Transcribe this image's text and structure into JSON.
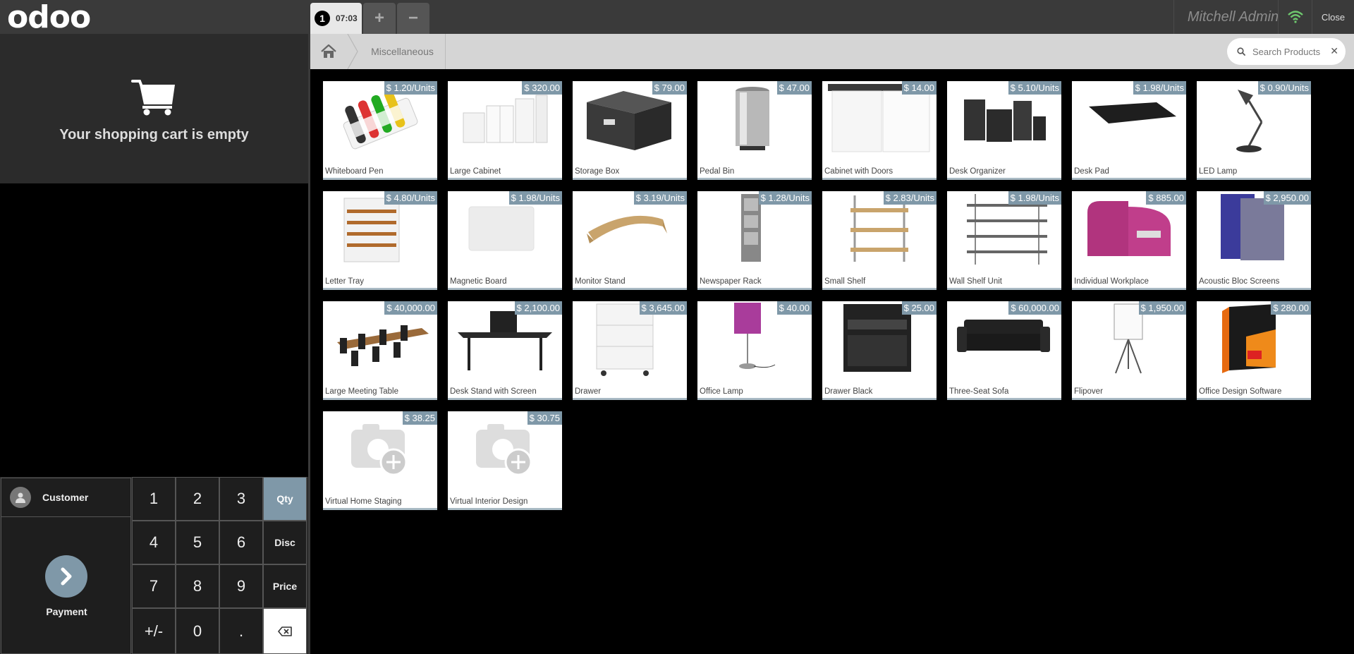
{
  "header": {
    "logo": "odoo",
    "order_number": "1",
    "order_time": "07:03",
    "add_icon": "+",
    "remove_icon": "−",
    "user": "Mitchell Admin",
    "close": "Close"
  },
  "cart": {
    "empty_message": "Your shopping cart is empty"
  },
  "actions": {
    "customer": "Customer",
    "payment": "Payment"
  },
  "numpad": {
    "k1": "1",
    "k2": "2",
    "k3": "3",
    "qty": "Qty",
    "k4": "4",
    "k5": "5",
    "k6": "6",
    "disc": "Disc",
    "k7": "7",
    "k8": "8",
    "k9": "9",
    "price": "Price",
    "plusminus": "+/-",
    "k0": "0",
    "dot": ".",
    "backspace": "⌫"
  },
  "breadcrumb": {
    "category": "Miscellaneous"
  },
  "search": {
    "placeholder": "Search Products",
    "clear": "✕"
  },
  "products": [
    {
      "name": "Whiteboard Pen",
      "price": "$ 1.20/Units"
    },
    {
      "name": "Large Cabinet",
      "price": "$ 320.00"
    },
    {
      "name": "Storage Box",
      "price": "$ 79.00"
    },
    {
      "name": "Pedal Bin",
      "price": "$ 47.00"
    },
    {
      "name": "Cabinet with Doors",
      "price": "$ 14.00"
    },
    {
      "name": "Desk Organizer",
      "price": "$ 5.10/Units"
    },
    {
      "name": "Desk Pad",
      "price": "$ 1.98/Units"
    },
    {
      "name": "LED Lamp",
      "price": "$ 0.90/Units"
    },
    {
      "name": "Letter Tray",
      "price": "$ 4.80/Units"
    },
    {
      "name": "Magnetic Board",
      "price": "$ 1.98/Units"
    },
    {
      "name": "Monitor Stand",
      "price": "$ 3.19/Units"
    },
    {
      "name": "Newspaper Rack",
      "price": "$ 1.28/Units"
    },
    {
      "name": "Small Shelf",
      "price": "$ 2.83/Units"
    },
    {
      "name": "Wall Shelf Unit",
      "price": "$ 1.98/Units"
    },
    {
      "name": "Individual Workplace",
      "price": "$ 885.00"
    },
    {
      "name": "Acoustic Bloc Screens",
      "price": "$ 2,950.00"
    },
    {
      "name": "Large Meeting Table",
      "price": "$ 40,000.00"
    },
    {
      "name": "Desk Stand with Screen",
      "price": "$ 2,100.00"
    },
    {
      "name": "Drawer",
      "price": "$ 3,645.00"
    },
    {
      "name": "Office Lamp",
      "price": "$ 40.00"
    },
    {
      "name": "Drawer Black",
      "price": "$ 25.00"
    },
    {
      "name": "Three-Seat Sofa",
      "price": "$ 60,000.00"
    },
    {
      "name": "Flipover",
      "price": "$ 1,950.00"
    },
    {
      "name": "Office Design Software",
      "price": "$ 280.00"
    },
    {
      "name": "Virtual Home Staging",
      "price": "$ 38.25"
    },
    {
      "name": "Virtual Interior Design",
      "price": "$ 30.75"
    }
  ],
  "colors": {
    "accent": "#7f98a8",
    "header_bg": "#3a3a3a",
    "wifi": "#6ec86e"
  }
}
